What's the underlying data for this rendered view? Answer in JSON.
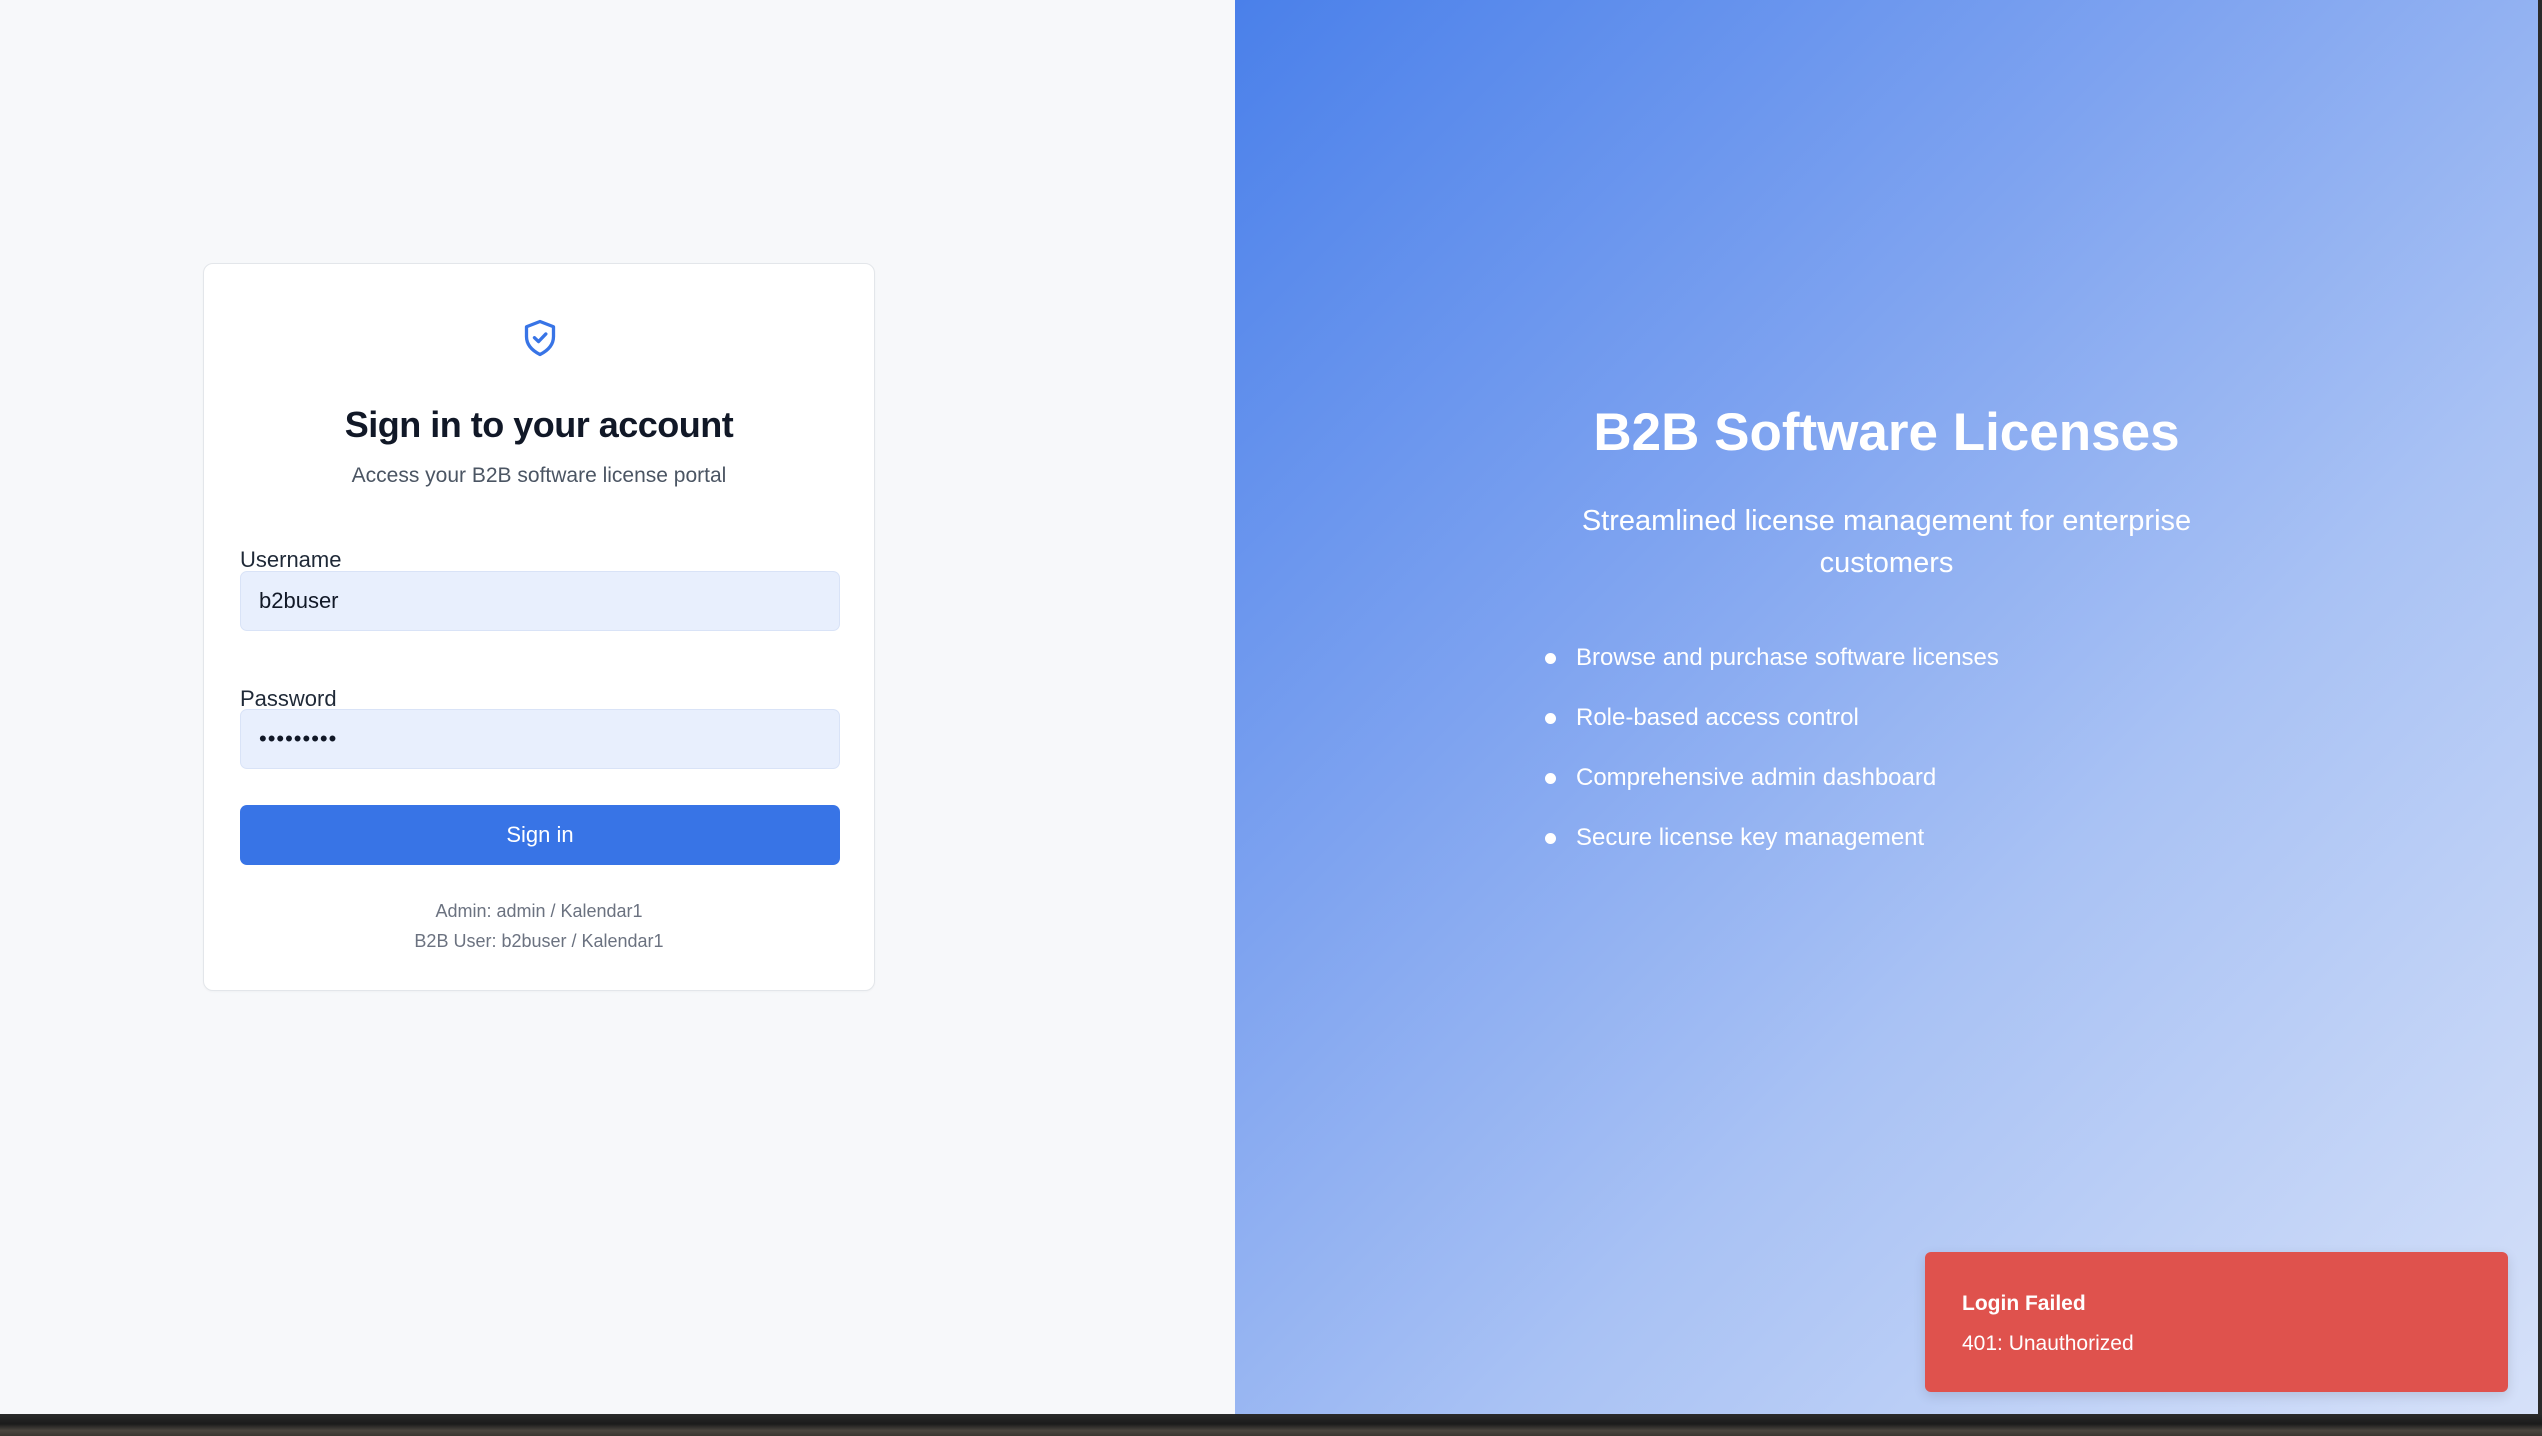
{
  "login": {
    "title": "Sign in to your account",
    "subtitle": "Access your B2B software license portal",
    "username_label": "Username",
    "username_value": "b2buser",
    "password_label": "Password",
    "password_value": "•••••••••",
    "signin_label": "Sign in",
    "hint_admin": "Admin: admin / Kalendar1",
    "hint_b2b": "B2B User: b2buser / Kalendar1",
    "logo_icon": "shield-check-icon"
  },
  "promo": {
    "title": "B2B Software Licenses",
    "description": "Streamlined license management for enterprise customers",
    "features": [
      "Browse and purchase software licenses",
      "Role-based access control",
      "Comprehensive admin dashboard",
      "Secure license key management"
    ]
  },
  "toast": {
    "title": "Login Failed",
    "message": "401: Unauthorized"
  },
  "colors": {
    "accent": "#3874e6",
    "error": "#df524d",
    "input_bg": "#e8effd"
  }
}
